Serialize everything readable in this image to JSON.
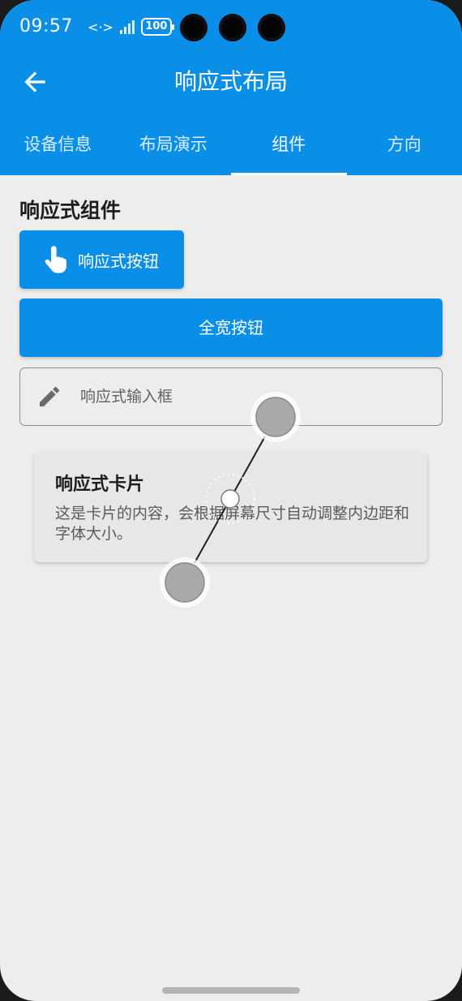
{
  "status_bar": {
    "time": "09:57",
    "network_glyph": "<·>",
    "battery": "100"
  },
  "header": {
    "title": "响应式布局",
    "back_icon": "arrow-left-icon"
  },
  "tabs": [
    {
      "label": "设备信息",
      "active": false
    },
    {
      "label": "布局演示",
      "active": false
    },
    {
      "label": "组件",
      "active": true
    },
    {
      "label": "方向",
      "active": false
    }
  ],
  "content": {
    "section_title": "响应式组件",
    "responsive_button": {
      "label": "响应式按钮",
      "icon": "touch-hand-icon"
    },
    "full_width_button": {
      "label": "全宽按钮"
    },
    "input": {
      "placeholder": "响应式输入框",
      "icon": "pencil-icon"
    },
    "card": {
      "title": "响应式卡片",
      "body": "这是卡片的内容，会根据屏幕尺寸自动调整内边距和字体大小。"
    }
  },
  "colors": {
    "primary": "#0a8fe8",
    "background": "#ededed",
    "card": "#e7e7e7",
    "text_dark": "#1d1d1d",
    "text_muted": "#5b5b5b"
  }
}
